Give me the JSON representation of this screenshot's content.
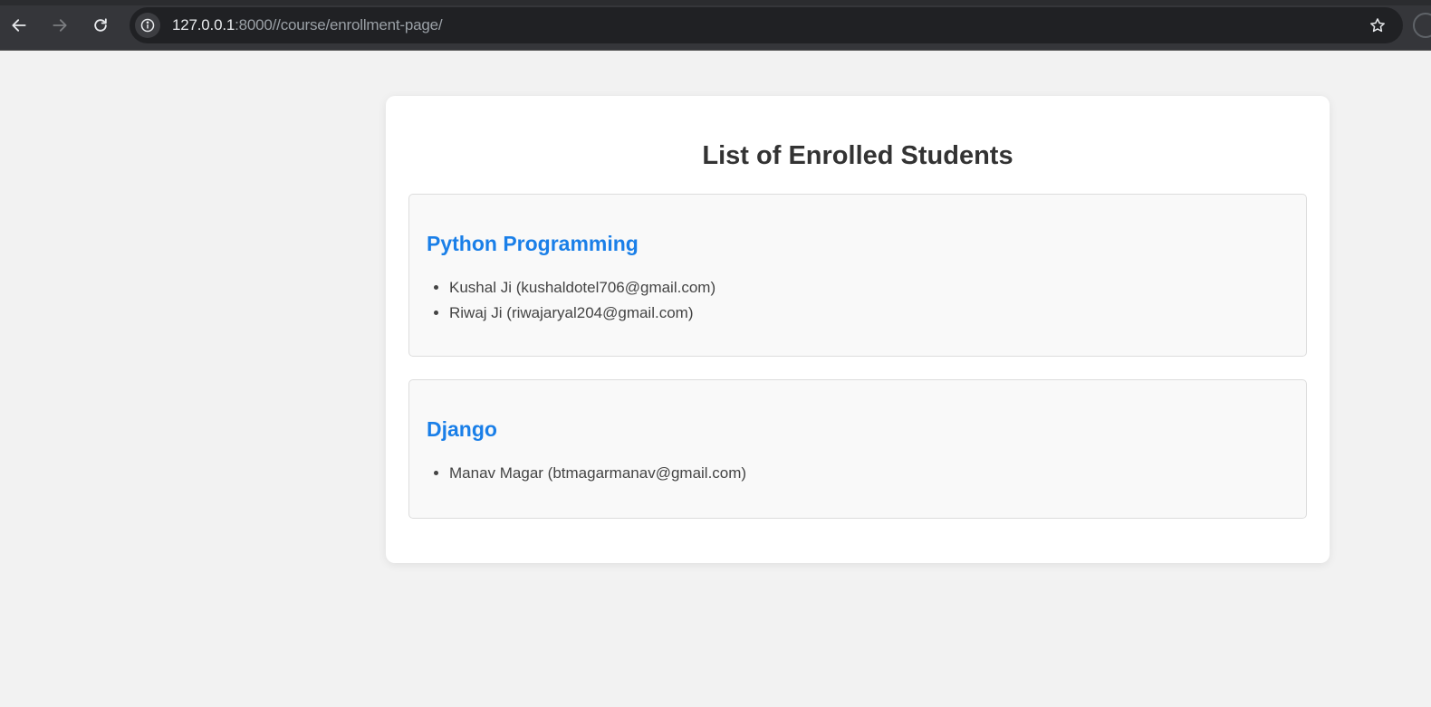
{
  "browser": {
    "url_host": "127.0.0.1",
    "url_rest": ":8000//course/enrollment-page/",
    "back_icon": "arrow-left-icon",
    "forward_icon": "arrow-right-icon",
    "reload_icon": "reload-icon",
    "site_info_icon": "info-icon",
    "bookmark_icon": "star-icon"
  },
  "page": {
    "title": "List of Enrolled Students",
    "courses": [
      {
        "name": "Python Programming",
        "students": [
          "Kushal Ji (kushaldotel706@gmail.com)",
          "Riwaj Ji (riwajaryal204@gmail.com)"
        ]
      },
      {
        "name": "Django",
        "students": [
          "Manav Magar (btmagarmanav@gmail.com)"
        ]
      }
    ]
  },
  "colors": {
    "course_title": "#1a7fe8",
    "page_background": "#f2f2f2",
    "card_background": "#ffffff",
    "course_box_background": "#f9f9f9"
  }
}
